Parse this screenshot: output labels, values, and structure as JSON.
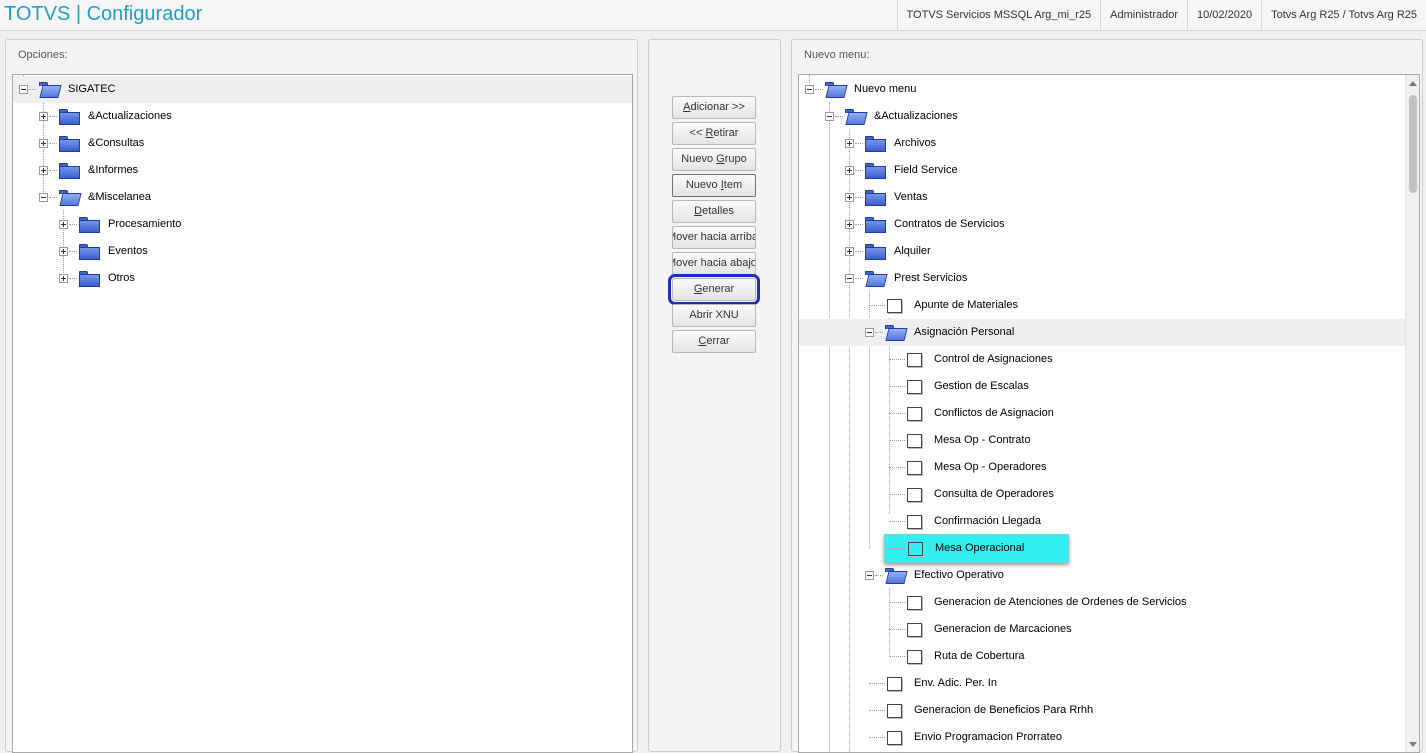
{
  "app": {
    "title": "TOTVS | Configurador"
  },
  "status": {
    "environment": "TOTVS Servicios MSSQL Arg_mi_r25",
    "user": "Administrador",
    "date": "10/02/2020",
    "branch": "Totvs Arg R25 / Totvs Arg R25"
  },
  "left_panel": {
    "title": "Opciones:",
    "tree": {
      "root": "SIGATEC",
      "actualizaciones": "&Actualizaciones",
      "consultas": "&Consultas",
      "informes": "&Informes",
      "miscelanea": "&Miscelanea",
      "procesamiento": "Procesamiento",
      "eventos": "Eventos",
      "otros": "Otros"
    }
  },
  "buttons": {
    "adicionar": {
      "pre": "",
      "key": "A",
      "post": "dicionar >>"
    },
    "retirar": {
      "pre": "<< ",
      "key": "R",
      "post": "etirar"
    },
    "nuevo_grupo": {
      "pre": "Nuevo ",
      "key": "G",
      "post": "rupo"
    },
    "nuevo_item": {
      "pre": "Nuevo ",
      "key": "I",
      "post": "tem"
    },
    "detalles": {
      "pre": "",
      "key": "D",
      "post": "etalles"
    },
    "mover_arriba": "Mover hacia arriba",
    "mover_abajo": "Mover hacia abajo",
    "generar": {
      "pre": "",
      "key": "G",
      "post": "enerar"
    },
    "abrir_xnu": "Abrir XNU",
    "cerrar": {
      "pre": "",
      "key": "C",
      "post": "errar"
    }
  },
  "right_panel": {
    "title": "Nuevo menu:",
    "tree": {
      "root": "Nuevo menu",
      "actualizaciones": "&Actualizaciones",
      "archivos": "Archivos",
      "field_service": "Field Service",
      "ventas": "Ventas",
      "contratos": "Contratos de Servicios",
      "alquiler": "Alquiler",
      "prest_servicios": "Prest Servicios",
      "apunte": "Apunte de Materiales",
      "asignacion": "Asignación Personal",
      "control": "Control de Asignaciones",
      "gestion": "Gestion de Escalas",
      "conflictos": "Conflictos de Asignacion",
      "mesa_contrato": "Mesa Op - Contrato",
      "mesa_operadores": "Mesa Op - Operadores",
      "consulta_operadores": "Consulta de Operadores",
      "confirmacion": "Confirmación Llegada",
      "mesa_operacional": "Mesa Operacional",
      "efectivo": "Efectivo Operativo",
      "generacion_atenciones": "Generacion de Atenciones de Ordenes de Servicios",
      "generacion_marcaciones": "Generacion de Marcaciones",
      "ruta": "Ruta de Cobertura",
      "env_adic": "Env. Adic. Per. In",
      "generacion_beneficios": "Generacion de Beneficios Para Rrhh",
      "envio_prog": "Envio Programacion Prorrateo"
    }
  },
  "colors": {
    "title": "#1f9dc9",
    "highlight": "#33f0f0",
    "focus_ring": "#1d2dc0",
    "folder": "#4466c8"
  },
  "icons": {
    "folder": "folder-icon",
    "open_folder": "folder-open-icon",
    "item": "menu-item-icon",
    "expand": "plus-box-icon",
    "collapse": "minus-box-icon"
  }
}
